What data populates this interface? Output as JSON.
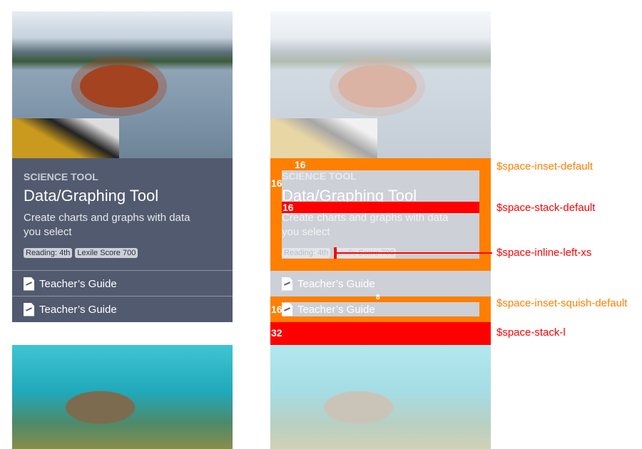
{
  "card": {
    "eyebrow": "SCIENCE TOOL",
    "title": "Data/Graphing Tool",
    "description": "Create charts and graphs with data you select",
    "tags": [
      "Reading: 4th",
      "Lexile Score 700"
    ],
    "links": [
      "Teacher’s Guide",
      "Teacher’s Guide"
    ]
  },
  "annotations": {
    "inset_default": {
      "label": "$space-inset-default",
      "value": "16",
      "color": "#ff7f00"
    },
    "stack_default": {
      "label": "$space-stack-default",
      "value": "16",
      "color": "#ff0000"
    },
    "inline_left_xs": {
      "label": "$space-inline-left-xs",
      "color": "#ff0000"
    },
    "inset_squish_default": {
      "label": "$space-inset-squish-default",
      "value_v": "8",
      "value_h": "16",
      "color": "#ff7f00"
    },
    "stack_l": {
      "label": "$space-stack-l",
      "value": "32",
      "color": "#ff0000"
    },
    "inset_left": "16"
  }
}
